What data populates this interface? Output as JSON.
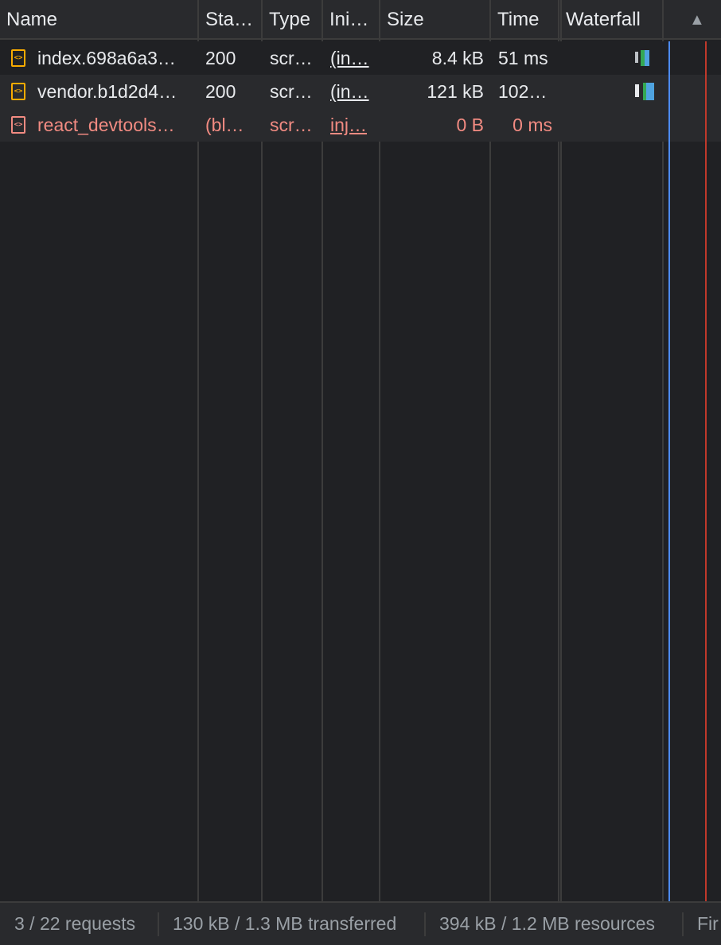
{
  "columns": {
    "name": "Name",
    "status": "Sta…",
    "type": "Type",
    "initiator": "Ini…",
    "size": "Size",
    "time": "Time",
    "waterfall": "Waterfall",
    "sort_indicator": "▲"
  },
  "rows": [
    {
      "name": "index.698a6a3…",
      "status": "200",
      "type": "scr…",
      "initiator": "(in…",
      "size": "8.4 kB",
      "time": "51 ms",
      "icon": "script-file-icon",
      "error": false
    },
    {
      "name": "vendor.b1d2d4…",
      "status": "200",
      "type": "scr…",
      "initiator": "(in…",
      "size": "121 kB",
      "time": "102…",
      "icon": "script-file-icon",
      "error": false
    },
    {
      "name": "react_devtools…",
      "status": "(bl…",
      "type": "scr…",
      "initiator": "inj…",
      "size": "0 B",
      "time": "0 ms",
      "icon": "script-file-icon",
      "error": true
    }
  ],
  "status_bar": {
    "requests": "3 / 22 requests",
    "transferred": "130 kB / 1.3 MB transferred",
    "resources": "394 kB / 1.2 MB resources",
    "finish": "Fir"
  },
  "colors": {
    "background": "#202124",
    "header": "#292a2d",
    "error_text": "#f28b82",
    "script_icon": "#f9ab00",
    "dom_content_loaded_line": "#4c8bf5",
    "load_line": "#c0392b"
  }
}
